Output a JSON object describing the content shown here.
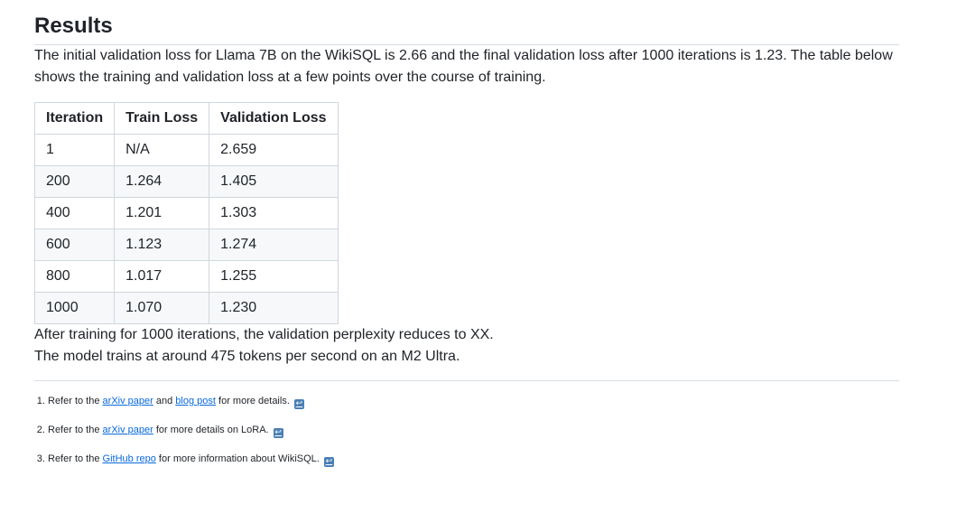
{
  "section": {
    "title": "Results"
  },
  "intro": "The initial validation loss for Llama 7B on the WikiSQL is 2.66 and the final validation loss after 1000 iterations is 1.23. The table below shows the training and validation loss at a few points over the course of training.",
  "table": {
    "headers": [
      "Iteration",
      "Train Loss",
      "Validation Loss"
    ],
    "rows": [
      [
        "1",
        "N/A",
        "2.659"
      ],
      [
        "200",
        "1.264",
        "1.405"
      ],
      [
        "400",
        "1.201",
        "1.303"
      ],
      [
        "600",
        "1.123",
        "1.274"
      ],
      [
        "800",
        "1.017",
        "1.255"
      ],
      [
        "1000",
        "1.070",
        "1.230"
      ]
    ]
  },
  "after_training": "After training for 1000 iterations, the validation perplexity reduces to XX.",
  "speed": "The model trains at around 475 tokens per second on an M2 Ultra.",
  "footnotes": [
    {
      "prefix": "Refer to the",
      "link1": "arXiv paper",
      "middle": "and",
      "link2": "blog post",
      "suffix": "for more details."
    },
    {
      "prefix": "Refer to the",
      "link1": "arXiv paper",
      "suffix": "for more details on LoRA."
    },
    {
      "prefix": "Refer to the",
      "link1": "GitHub repo",
      "suffix": "for more information about WikiSQL."
    }
  ],
  "icons": {
    "backref": "return-arrow-icon",
    "backref_glyph": "↩",
    "backref_color": "#4a7fb5"
  },
  "colors": {
    "link": "#0969da",
    "border": "#d0d7de",
    "row_alt": "#f6f8fa"
  }
}
